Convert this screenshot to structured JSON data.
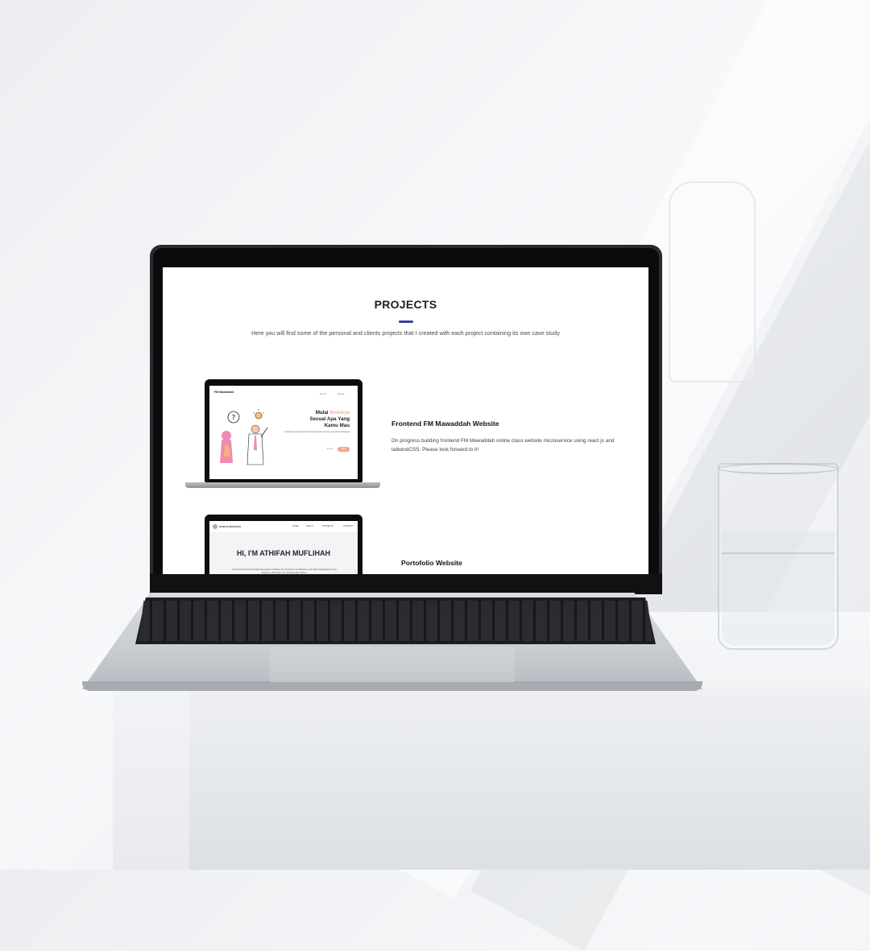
{
  "projects_page": {
    "title": "PROJECTS",
    "intro": "Here you will find some of the personal and clients projects that I created with each project containing its own case study",
    "accent_color": "#3b3ba3"
  },
  "projects": [
    {
      "title": "Frontend FM Mawaddah Website",
      "description": "On progress building frontend FM Mawaddah online class website microservice using react js and tailwindCSS. Please look forward to it!",
      "preview": {
        "brand": "FM Mawaddah",
        "nav": [
          "Mentor",
          "Masuk"
        ],
        "hero_line1_prefix": "Mulai ",
        "hero_line1_accent": "Berkarya",
        "hero_line2": "Sesual Apa Yang",
        "hero_line3": "Kamu Mau",
        "sub": "Tetapkan kemampuan dan berkarya bersama mentor yang ahli di bidangnya",
        "link": "Explore",
        "button": "Daftar",
        "accent_color": "#ef9a7a"
      }
    },
    {
      "title": "Portofolio Website",
      "description": "",
      "preview": {
        "brand": "ATHIFAH MUFLIHAH",
        "nav": [
          "HOME",
          "ABOUT",
          "PROJECTS",
          "CONTACT"
        ],
        "hero": "HI, I'M ATHIFAH MUFLIHAH",
        "sub": "A Frontend Focused Web Developer building the Frontend of Websites and Web Applications that leads to effortless and aesthetically deliver"
      }
    }
  ],
  "icons": [
    "question-icon",
    "lightbulb-icon"
  ]
}
